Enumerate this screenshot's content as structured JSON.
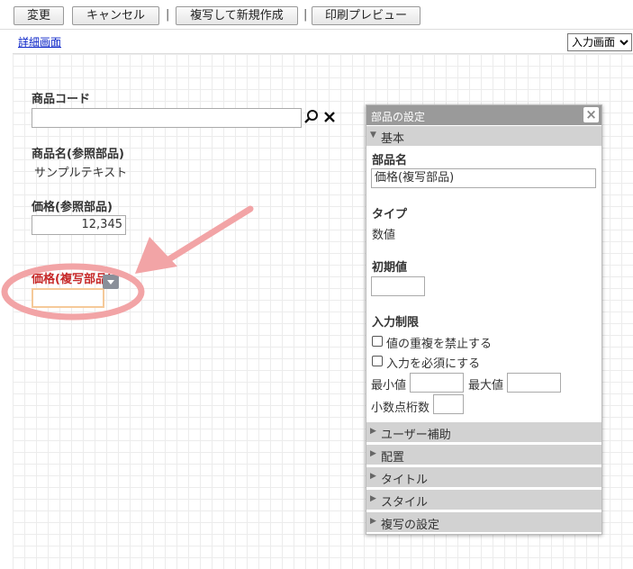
{
  "toolbar": {
    "change_label": "変更",
    "cancel_label": "キャンセル",
    "separator1": "|",
    "copy_new_label": "複写して新規作成",
    "separator2": "|",
    "print_preview_label": "印刷プレビュー"
  },
  "subheader": {
    "detail_link": "詳細画面",
    "view_select": {
      "selected": "入力画面"
    }
  },
  "form": {
    "product_code_label": "商品コード",
    "product_name_label": "商品名(参照部品)",
    "product_name_value": "サンプルテキスト",
    "price_ref_label": "価格(参照部品)",
    "price_ref_value": "12,345",
    "price_copy_label": "価格(複写部品)"
  },
  "panel": {
    "title": "部品の設定",
    "close": "×",
    "basic_section": "基本",
    "part_name_label": "部品名",
    "part_name_value": "価格(複写部品)",
    "type_label": "タイプ",
    "type_value": "数値",
    "initial_label": "初期値",
    "restriction_label": "入力制限",
    "no_duplicate": "値の重複を禁止する",
    "required": "入力を必須にする",
    "min_label": "最小値",
    "max_label": "最大値",
    "decimal_label": "小数点桁数",
    "sections": [
      "ユーザー補助",
      "配置",
      "タイトル",
      "スタイル",
      "複写の設定"
    ]
  },
  "colors": {
    "annotation": "#f2a4a6",
    "highlight_label": "#c62828",
    "link": "#0b24c8"
  }
}
